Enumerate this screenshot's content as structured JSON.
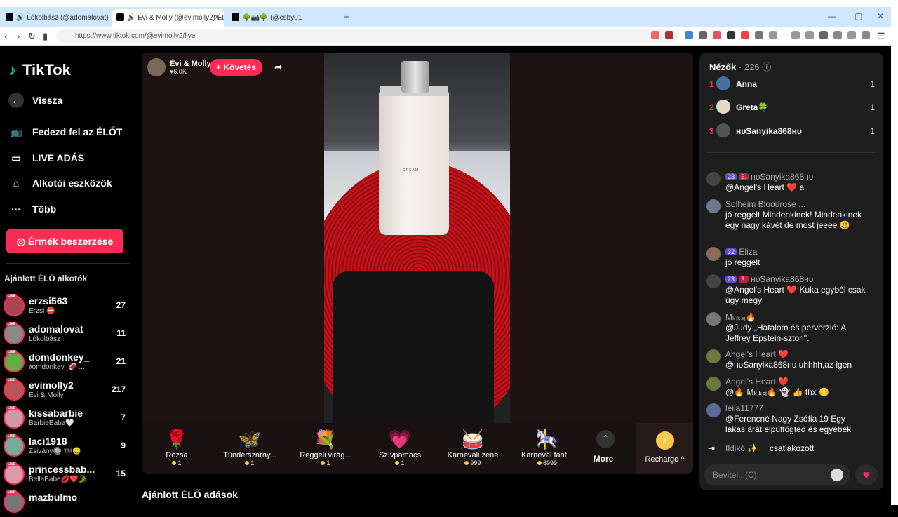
{
  "browser": {
    "tabs": [
      {
        "label": "Lókolbász (@adomalovat) ÉLŐ a"
      },
      {
        "label": "Évi & Molly (@evimolly2) ÉLŐ"
      },
      {
        "label": "🌳📷🌳 (@csby01"
      }
    ],
    "url": "https://www.tiktok.com/@evimolly2/live"
  },
  "sidebar": {
    "logo": "TikTok",
    "back": "Vissza",
    "items": [
      {
        "label": "Fedezd fel az ÉLŐT",
        "icon": "tv-icon"
      },
      {
        "label": "LIVE ADÁS",
        "icon": "camera-icon"
      },
      {
        "label": "Alkotói eszközök",
        "icon": "home-icon"
      },
      {
        "label": "Több",
        "icon": "more-icon"
      }
    ],
    "coins_button": "Érmék beszerzése",
    "section_title": "Ajánlott ÉLŐ alkotók",
    "creators": [
      {
        "name": "erzsi563",
        "sub": "Erzsi ⛔",
        "count": "27"
      },
      {
        "name": "adomalovat",
        "sub": "Lókolbász",
        "count": "11"
      },
      {
        "name": "domdonkey_",
        "sub": "𝔡omdonkey_🏈 ...",
        "count": "21"
      },
      {
        "name": "evimolly2",
        "sub": "Évi & Molly",
        "count": "217"
      },
      {
        "name": "kissabarbie",
        "sub": "BarbieBaba🤍",
        "count": "7"
      },
      {
        "name": "laci1918",
        "sub": "Zsivány🔘 ™️😀",
        "count": "9"
      },
      {
        "name": "princessbab...",
        "sub": "BellaBabe💋❤️🐊",
        "count": "15"
      },
      {
        "name": "mazbulmo",
        "sub": "",
        "count": ""
      }
    ]
  },
  "stream": {
    "streamer": "Évi & Molly",
    "likes": "♥6.0K",
    "follow": "+ Követés",
    "bottle_label": "CREAM"
  },
  "gifts": [
    {
      "name": "Rózsa",
      "price": "1",
      "icon": "🌹"
    },
    {
      "name": "Tündérszárny...",
      "price": "1",
      "icon": "🦋"
    },
    {
      "name": "Reggeli virág...",
      "price": "1",
      "icon": "💐"
    },
    {
      "name": "Szívpamacs",
      "price": "1",
      "icon": "💗"
    },
    {
      "name": "Karneváli zene",
      "price": "999",
      "icon": "🥁"
    },
    {
      "name": "Karnevál fant...",
      "price": "6999",
      "icon": "🎠"
    }
  ],
  "more": "More",
  "recharge": "Recharge ^",
  "recommended": "Ajánlott ÉLŐ adások",
  "viewers": {
    "title": "Nézők",
    "count": "· 226",
    "list": [
      {
        "rank": "1",
        "name": "Anna",
        "value": "1"
      },
      {
        "rank": "2",
        "name": "Greta🍀",
        "value": "1"
      },
      {
        "rank": "3",
        "name": "ʜᴜSanyika868ʜᴜ",
        "value": "1"
      }
    ]
  },
  "chat": [
    {
      "user": "ʜᴜSanyika868ʜᴜ",
      "badges": [
        "23",
        "3."
      ],
      "text": "@Angel's Heart ❤️ a"
    },
    {
      "user": "Solheim Bloodrose ...",
      "badges": [],
      "text": "jó reggelt Mindenkinek! Mindenkinek egy nagy kávét de most jeeee 😃"
    },
    {
      "user": "Eliza",
      "badges": [
        "32"
      ],
      "text": "jó reggelt"
    },
    {
      "user": "ʜᴜSanyika868ʜᴜ",
      "badges": [
        "23",
        "3."
      ],
      "text": "@Angel's Heart ❤️ Kuka egyből csak úgy megy"
    },
    {
      "user": "Mₖᵢₖₛᵢ🔥",
      "badges": [],
      "text": "@Judy „Hatalom és perverzió: A Jeffrey Epstein-sztori\"."
    },
    {
      "user": "Angel's Heart ❤️",
      "badges": [],
      "text": "@ʜᴜSanyika868ʜᴜ uhhhh,az igen"
    },
    {
      "user": "Angel's Heart ❤️",
      "badges": [],
      "text": "@🔥 Mₖᵢₖₛᵢ🔥 👻 👍 thx 😊"
    },
    {
      "user": "leila11777",
      "badges": [],
      "text": "@Ferencné Nagy Zsófia 19 Egy lakás árát elpüffögted és egyebek"
    }
  ],
  "join": {
    "user": "Ildikó ✨",
    "text": "csatlakozott"
  },
  "input_placeholder": "Bevitel...(C)"
}
